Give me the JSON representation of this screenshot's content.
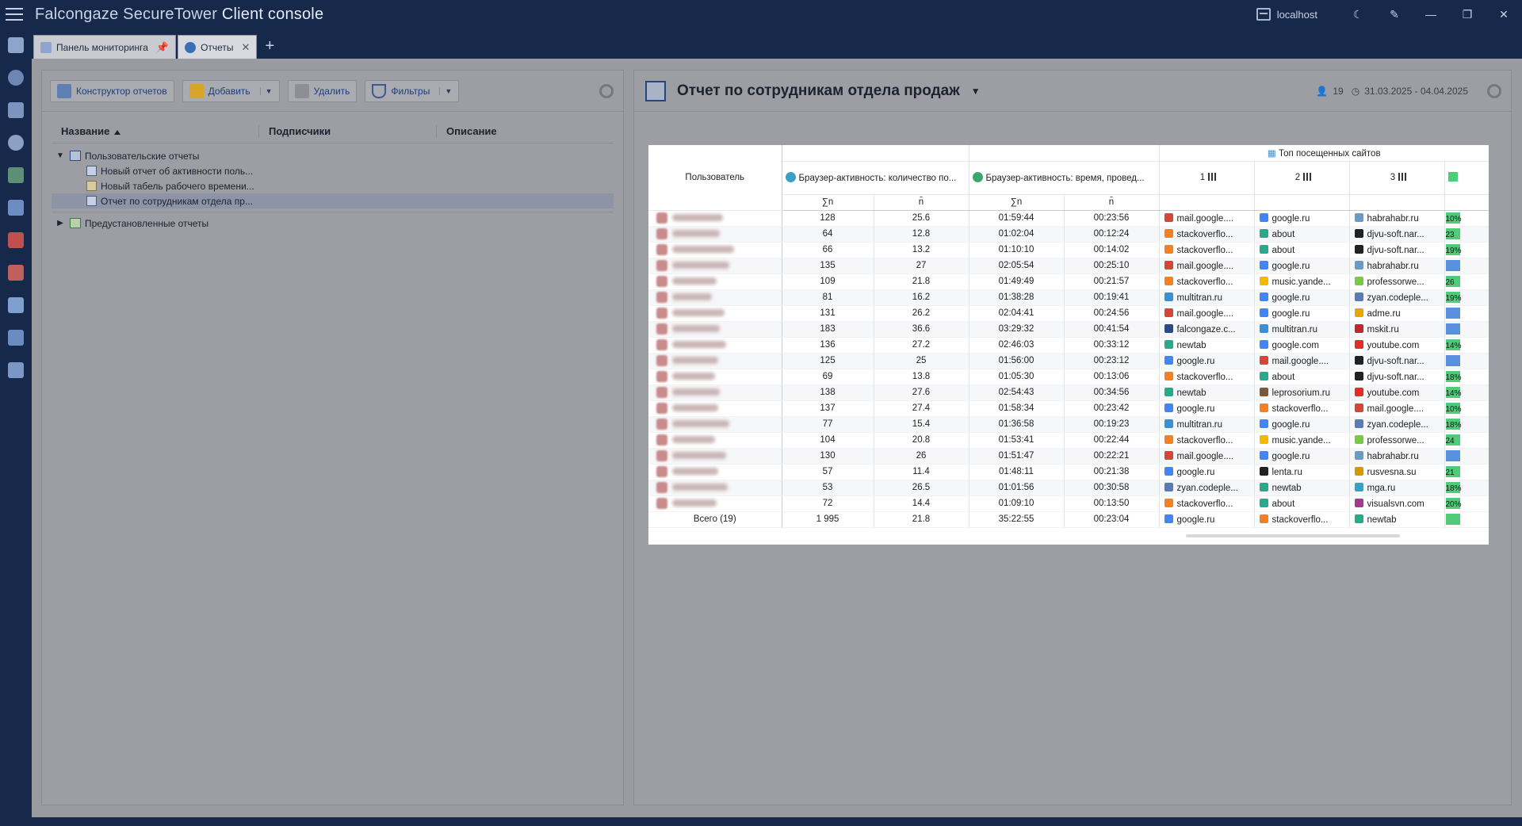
{
  "app": {
    "title_prefix": "Falcongaze SecureTower ",
    "title_suffix": "Client console",
    "server": "localhost"
  },
  "tabs": [
    {
      "label": "Панель мониторинга"
    },
    {
      "label": "Отчеты"
    }
  ],
  "toolbar": {
    "constructor_label": "Конструктор отчетов",
    "add_label": "Добавить",
    "delete_label": "Удалить",
    "filters_label": "Фильтры"
  },
  "tree": {
    "col_name": "Название",
    "col_subscribers": "Подписчики",
    "col_description": "Описание",
    "user_group": "Пользовательские отчеты",
    "items": [
      "Новый отчет об активности поль...",
      "Новый табель рабочего времени...",
      "Отчет по сотрудникам отдела пр..."
    ],
    "preset_group": "Предустановленные отчеты"
  },
  "report": {
    "title": "Отчет по сотрудникам отдела продаж",
    "users_count": "19",
    "date_range": "31.03.2025 - 04.04.2025",
    "col_user": "Пользователь",
    "col_count": "Браузер-активность: количество по...",
    "col_time": "Браузер-активность: время, провед...",
    "col_top": "Топ посещенных сайтов",
    "sub_sum": "∑n",
    "sub_avg": "n̄",
    "rank1": "1",
    "rank2": "2",
    "rank3": "3",
    "total_label": "Всего (19)",
    "rows": [
      {
        "cnt": "128",
        "cnt_avg": "25.6",
        "time": "01:59:44",
        "time_avg": "00:23:56",
        "s1": "mail.google....",
        "s2": "google.ru",
        "s3": "habrahabr.ru",
        "pct": "10%"
      },
      {
        "cnt": "64",
        "cnt_avg": "12.8",
        "time": "01:02:04",
        "time_avg": "00:12:24",
        "s1": "stackoverflo...",
        "s2": "about",
        "s3": "djvu-soft.nar...",
        "pct": "23"
      },
      {
        "cnt": "66",
        "cnt_avg": "13.2",
        "time": "01:10:10",
        "time_avg": "00:14:02",
        "s1": "stackoverflo...",
        "s2": "about",
        "s3": "djvu-soft.nar...",
        "pct": "19%"
      },
      {
        "cnt": "135",
        "cnt_avg": "27",
        "time": "02:05:54",
        "time_avg": "00:25:10",
        "s1": "mail.google....",
        "s2": "google.ru",
        "s3": "habrahabr.ru",
        "pct": ""
      },
      {
        "cnt": "109",
        "cnt_avg": "21.8",
        "time": "01:49:49",
        "time_avg": "00:21:57",
        "s1": "stackoverflo...",
        "s2": "music.yande...",
        "s3": "professorwe...",
        "pct": "26"
      },
      {
        "cnt": "81",
        "cnt_avg": "16.2",
        "time": "01:38:28",
        "time_avg": "00:19:41",
        "s1": "multitran.ru",
        "s2": "google.ru",
        "s3": "zyan.codeple...",
        "pct": "19%"
      },
      {
        "cnt": "131",
        "cnt_avg": "26.2",
        "time": "02:04:41",
        "time_avg": "00:24:56",
        "s1": "mail.google....",
        "s2": "google.ru",
        "s3": "adme.ru",
        "pct": ""
      },
      {
        "cnt": "183",
        "cnt_avg": "36.6",
        "time": "03:29:32",
        "time_avg": "00:41:54",
        "s1": "falcongaze.c...",
        "s2": "multitran.ru",
        "s3": "mskit.ru",
        "pct": ""
      },
      {
        "cnt": "136",
        "cnt_avg": "27.2",
        "time": "02:46:03",
        "time_avg": "00:33:12",
        "s1": "newtab",
        "s2": "google.com",
        "s3": "youtube.com",
        "pct": "14%"
      },
      {
        "cnt": "125",
        "cnt_avg": "25",
        "time": "01:56:00",
        "time_avg": "00:23:12",
        "s1": "google.ru",
        "s2": "mail.google....",
        "s3": "djvu-soft.nar...",
        "pct": ""
      },
      {
        "cnt": "69",
        "cnt_avg": "13.8",
        "time": "01:05:30",
        "time_avg": "00:13:06",
        "s1": "stackoverflo...",
        "s2": "about",
        "s3": "djvu-soft.nar...",
        "pct": "18%"
      },
      {
        "cnt": "138",
        "cnt_avg": "27.6",
        "time": "02:54:43",
        "time_avg": "00:34:56",
        "s1": "newtab",
        "s2": "leprosorium.ru",
        "s3": "youtube.com",
        "pct": "14%"
      },
      {
        "cnt": "137",
        "cnt_avg": "27.4",
        "time": "01:58:34",
        "time_avg": "00:23:42",
        "s1": "google.ru",
        "s2": "stackoverflo...",
        "s3": "mail.google....",
        "pct": "10%"
      },
      {
        "cnt": "77",
        "cnt_avg": "15.4",
        "time": "01:36:58",
        "time_avg": "00:19:23",
        "s1": "multitran.ru",
        "s2": "google.ru",
        "s3": "zyan.codeple...",
        "pct": "18%"
      },
      {
        "cnt": "104",
        "cnt_avg": "20.8",
        "time": "01:53:41",
        "time_avg": "00:22:44",
        "s1": "stackoverflo...",
        "s2": "music.yande...",
        "s3": "professorwe...",
        "pct": "24"
      },
      {
        "cnt": "130",
        "cnt_avg": "26",
        "time": "01:51:47",
        "time_avg": "00:22:21",
        "s1": "mail.google....",
        "s2": "google.ru",
        "s3": "habrahabr.ru",
        "pct": ""
      },
      {
        "cnt": "57",
        "cnt_avg": "11.4",
        "time": "01:48:11",
        "time_avg": "00:21:38",
        "s1": "google.ru",
        "s2": "lenta.ru",
        "s3": "rusvesna.su",
        "pct": "21"
      },
      {
        "cnt": "53",
        "cnt_avg": "26.5",
        "time": "01:01:56",
        "time_avg": "00:30:58",
        "s1": "zyan.codeple...",
        "s2": "newtab",
        "s3": "mga.ru",
        "pct": "18%"
      },
      {
        "cnt": "72",
        "cnt_avg": "14.4",
        "time": "01:09:10",
        "time_avg": "00:13:50",
        "s1": "stackoverflo...",
        "s2": "about",
        "s3": "visualsvn.com",
        "pct": "20%"
      }
    ],
    "total": {
      "cnt": "1 995",
      "cnt_avg": "21.8",
      "time": "35:22:55",
      "time_avg": "00:23:04",
      "s1": "google.ru",
      "s2": "stackoverflo...",
      "s3": "newtab"
    }
  },
  "favicons": {
    "mail.google....": "#d44638",
    "google.ru": "#4285f4",
    "google.com": "#4285f4",
    "habrahabr.ru": "#6b9ac4",
    "stackoverflo...": "#f48024",
    "about": "#2aa88a",
    "newtab": "#2aa88a",
    "djvu-soft.nar...": "#222222",
    "music.yande...": "#f5b800",
    "professorwe...": "#7ac943",
    "multitran.ru": "#3a8fd6",
    "zyan.codeple...": "#5a7bb5",
    "adme.ru": "#e5a800",
    "falcongaze.c...": "#2b4a8c",
    "mskit.ru": "#c0282d",
    "youtube.com": "#e52d27",
    "leprosorium.ru": "#7a5a3a",
    "lenta.ru": "#222222",
    "rusvesna.su": "#d49a00",
    "mga.ru": "#3aa0c8",
    "visualsvn.com": "#a33b8c"
  }
}
